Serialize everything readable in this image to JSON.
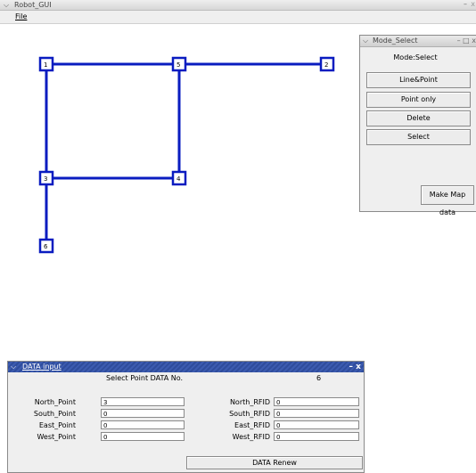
{
  "window": {
    "title": "Robot_GUI",
    "minimize": "–",
    "close": "x"
  },
  "menu": {
    "file": "File"
  },
  "map": {
    "nodes": [
      {
        "id": "1"
      },
      {
        "id": "5"
      },
      {
        "id": "2"
      },
      {
        "id": "3"
      },
      {
        "id": "4"
      },
      {
        "id": "6"
      }
    ],
    "line_color": "#0a1cc0",
    "node_fill": "#ffffff"
  },
  "mode_window": {
    "title": "Mode_Select",
    "controls": "– □ x",
    "mode_label": "Mode:Select",
    "buttons": [
      "Line&Point",
      "Point only",
      "Delete",
      "Select"
    ],
    "make_map": "Make Map data"
  },
  "data_window": {
    "title": "DATA input",
    "controls": "– x",
    "select_label": "Select Point DATA No.",
    "select_value": "6",
    "left_labels": [
      "North_Point",
      "South_Point",
      "East_Point",
      "West_Point"
    ],
    "left_values": [
      "3",
      "0",
      "0",
      "0"
    ],
    "right_labels": [
      "North_RFID",
      "South_RFID",
      "East_RFID",
      "West_RFID"
    ],
    "right_values": [
      "0",
      "0",
      "0",
      "0"
    ],
    "renew": "DATA Renew"
  }
}
